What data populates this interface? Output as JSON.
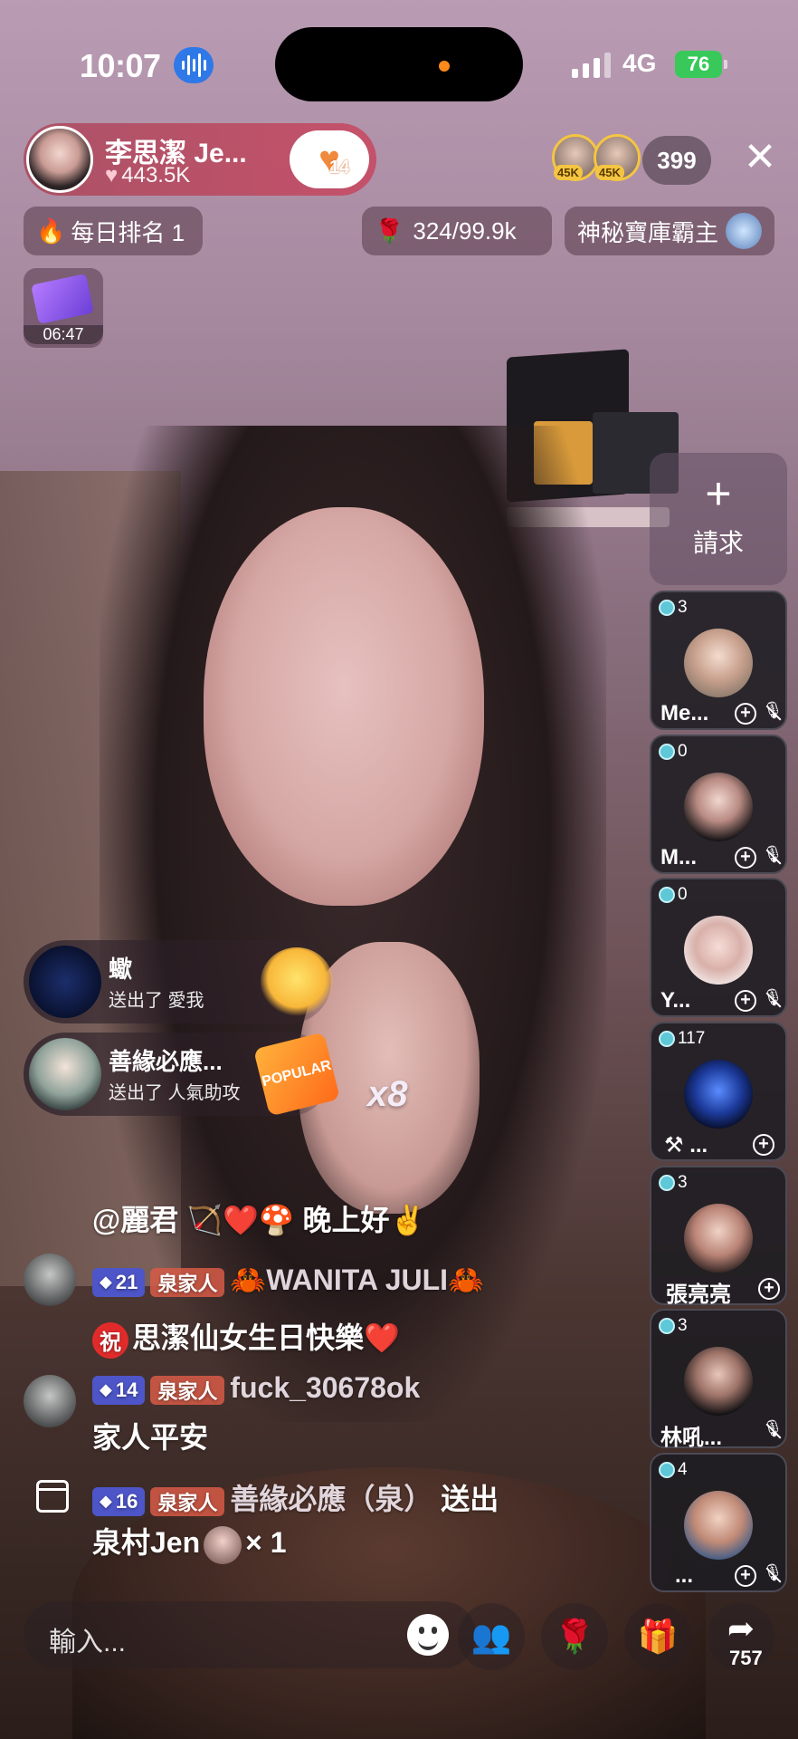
{
  "status": {
    "time": "10:07",
    "network": "4G",
    "battery": "76"
  },
  "host": {
    "name": "李思潔 Je...",
    "likes": "443.5K",
    "follow_count": "14"
  },
  "viewers": {
    "badges": [
      "45K",
      "45K"
    ],
    "count": "399"
  },
  "info_row": {
    "ranking": "每日排名 1",
    "rose_progress": "324/99.9k",
    "treasure": "神秘寶庫霸主"
  },
  "gift_timer": "06:47",
  "request": {
    "label": "請求"
  },
  "guests": [
    {
      "score": "3",
      "name": "Me..."
    },
    {
      "score": "0",
      "name": "M..."
    },
    {
      "score": "0",
      "name": "Y..."
    },
    {
      "score": "117",
      "name": "..."
    },
    {
      "score": "3",
      "name": "張亮亮"
    },
    {
      "score": "3",
      "name": "林吼..."
    },
    {
      "score": "4",
      "name": "..."
    }
  ],
  "gift_notes": [
    {
      "name": "蠍",
      "sent": "送出了 愛我"
    },
    {
      "name": "善緣必應...",
      "sent": "送出了 人氣助攻",
      "gift_label": "POPULAR"
    }
  ],
  "multiplier": "x8",
  "chat": [
    {
      "text": "@麗君 🏹❤️🍄 晚上好✌️"
    },
    {
      "level": "21",
      "family": "泉家人",
      "user": "🦀WANITA JULI🦀"
    },
    {
      "blessing": "祝",
      "text": "思潔仙女生日快樂❤️"
    },
    {
      "level": "14",
      "family": "泉家人",
      "user": "fuck_30678ok"
    },
    {
      "text": "家人平安"
    },
    {
      "level": "16",
      "family": "泉家人",
      "user": "善緣必應（泉）",
      "action": "送出"
    },
    {
      "gift_to": "泉村Jen",
      "count": "× 1"
    }
  ],
  "bottom": {
    "input_placeholder": "輸入...",
    "share_count": "757"
  },
  "icons": {
    "close": "✕",
    "plus": "+",
    "gem": "◆",
    "heart": "♥",
    "rose": "🌹",
    "fire": "🔥",
    "gift": "🎁",
    "share": "➦",
    "people": "👥"
  },
  "colors": {
    "battery": "#38c95a",
    "voice": "#2f78e8",
    "level_badge": "#4d55c8",
    "family_badge": "#d75a46"
  }
}
